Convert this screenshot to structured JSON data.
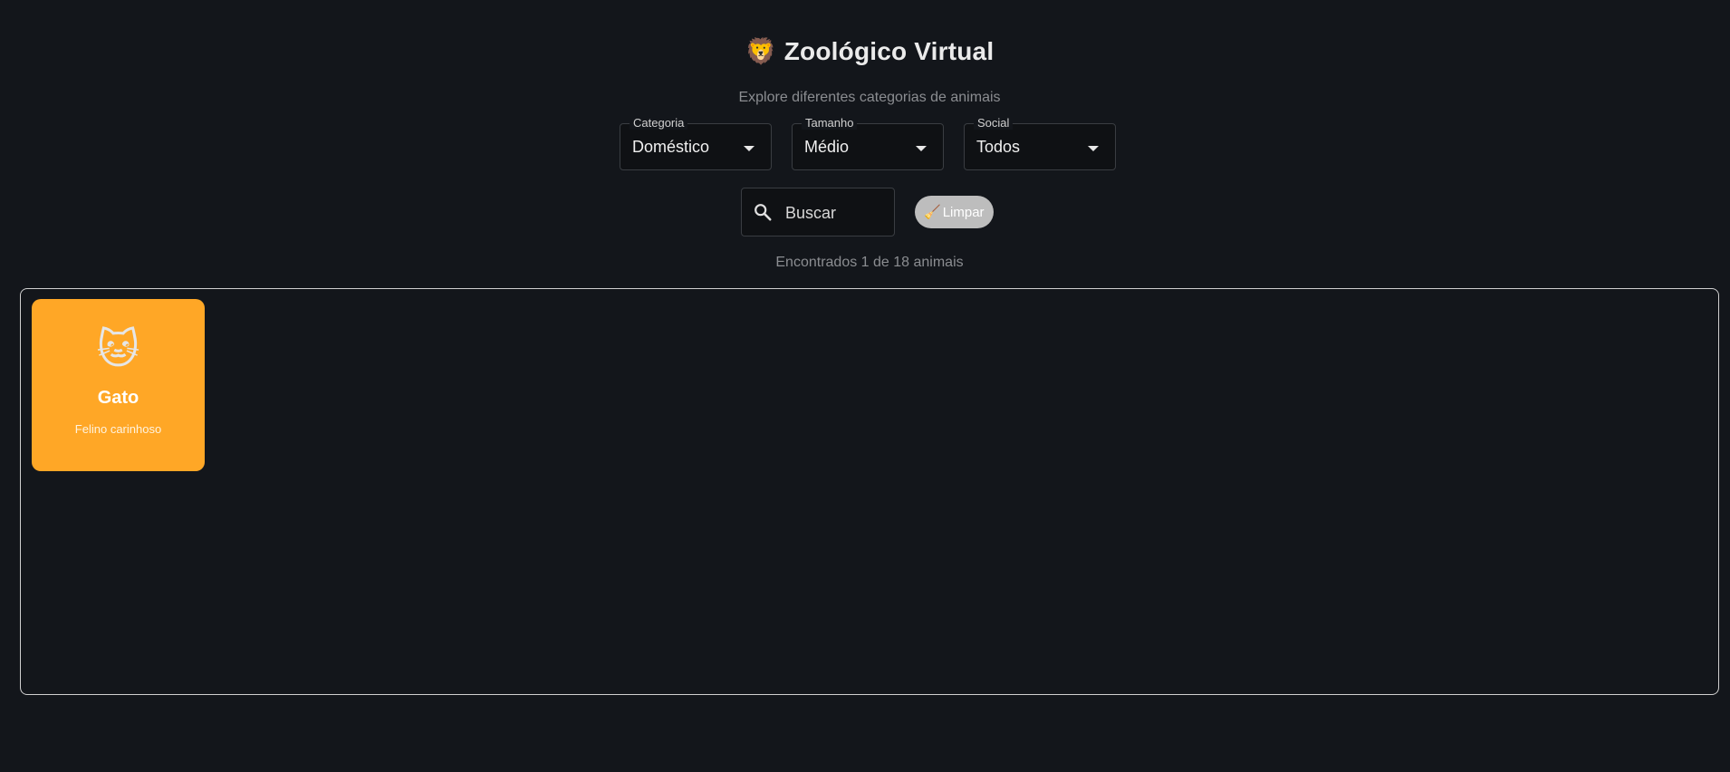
{
  "header": {
    "title_icon": "🦁",
    "title": "Zoológico Virtual",
    "subtitle": "Explore diferentes categorias de animais"
  },
  "filters": [
    {
      "label": "Categoria",
      "value": "Doméstico"
    },
    {
      "label": "Tamanho",
      "value": "Médio"
    },
    {
      "label": "Social",
      "value": "Todos"
    }
  ],
  "search": {
    "placeholder": "Buscar",
    "icon": "search-icon"
  },
  "clear_button": {
    "icon": "🧹",
    "label": "Limpar",
    "color": "#bdbdbd"
  },
  "results": {
    "count_text": "Encontrados 1 de 18 animais"
  },
  "animals": [
    {
      "emoji": "🐱",
      "name": "Gato",
      "description": "Felino carinhoso",
      "color": "#ffa726"
    }
  ],
  "colors": {
    "background": "#13161b",
    "card_accent": "#ffa726"
  }
}
